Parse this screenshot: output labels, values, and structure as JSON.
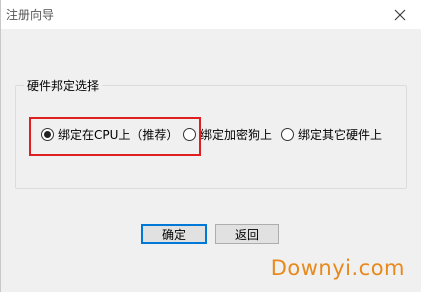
{
  "window": {
    "title": "注册向导",
    "close_icon": "close-icon"
  },
  "group": {
    "legend": "硬件邦定选择",
    "options": [
      {
        "label": "绑定在CPU上（推荐）",
        "selected": true
      },
      {
        "label": "绑定加密狗上",
        "selected": false
      },
      {
        "label": "绑定其它硬件上",
        "selected": false
      }
    ]
  },
  "buttons": {
    "ok_label": "确定",
    "back_label": "返回"
  },
  "watermark": "Downyi.com",
  "colors": {
    "highlight": "#e02020",
    "watermark": "#e8891c",
    "focus_border": "#0078d7"
  }
}
